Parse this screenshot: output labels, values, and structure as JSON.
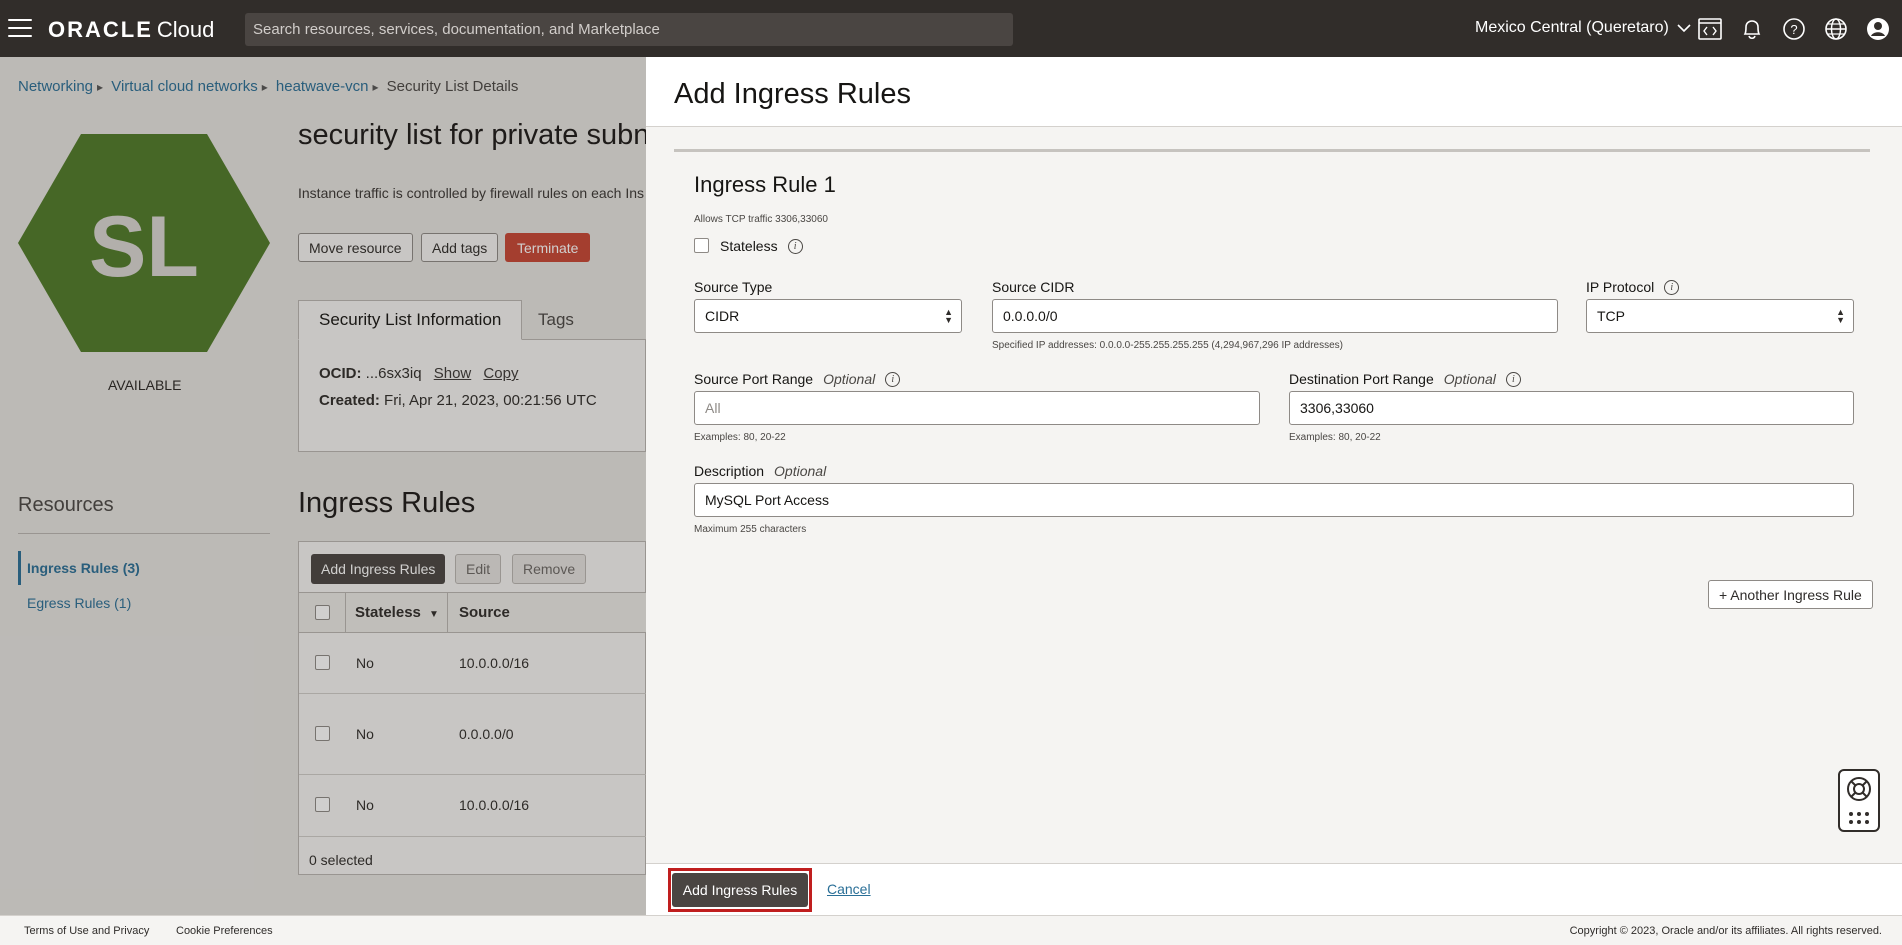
{
  "topbar": {
    "logo_brand": "ORACLE",
    "logo_product": "Cloud",
    "search_placeholder": "Search resources, services, documentation, and Marketplace",
    "region": "Mexico Central (Queretaro)",
    "icons": [
      "menu-icon",
      "cloud-shell-icon",
      "bell-icon",
      "help-icon",
      "globe-icon",
      "user-icon"
    ]
  },
  "breadcrumb": {
    "items": [
      "Networking",
      "Virtual cloud networks",
      "heatwave-vcn"
    ],
    "current": "Security List Details"
  },
  "resource": {
    "badge": "SL",
    "badge_color": "#4f7a28",
    "status": "AVAILABLE",
    "title": "security list for private subne",
    "description": "Instance traffic is controlled by firewall rules on each Ins",
    "actions": {
      "move": "Move resource",
      "tags": "Add tags",
      "terminate": "Terminate"
    },
    "tabs": [
      "Security List Information",
      "Tags"
    ],
    "ocid_label": "OCID:",
    "ocid_value": "...6sx3iq",
    "show": "Show",
    "copy": "Copy",
    "created_label": "Created:",
    "created_value": "Fri, Apr 21, 2023, 00:21:56 UTC"
  },
  "resources_nav": {
    "heading": "Resources",
    "items": [
      "Ingress Rules (3)",
      "Egress Rules (1)"
    ]
  },
  "ingress_section": {
    "heading": "Ingress Rules",
    "add_button": "Add Ingress Rules",
    "edit_button": "Edit",
    "remove_button": "Remove",
    "columns": [
      "Stateless",
      "Source"
    ],
    "rows": [
      {
        "stateless": "No",
        "source": "10.0.0.0/16"
      },
      {
        "stateless": "No",
        "source": "0.0.0.0/0"
      },
      {
        "stateless": "No",
        "source": "10.0.0.0/16"
      }
    ],
    "selected_count": "0 selected"
  },
  "panel": {
    "title": "Add Ingress Rules",
    "rule_title": "Ingress Rule 1",
    "rule_subtitle": "Allows TCP traffic 3306,33060",
    "stateless_label": "Stateless",
    "source_type": {
      "label": "Source Type",
      "value": "CIDR"
    },
    "source_cidr": {
      "label": "Source CIDR",
      "value": "0.0.0.0/0",
      "hint": "Specified IP addresses: 0.0.0.0-255.255.255.255 (4,294,967,296 IP addresses)"
    },
    "ip_protocol": {
      "label": "IP Protocol",
      "value": "TCP"
    },
    "source_port": {
      "label": "Source Port Range",
      "optional": "Optional",
      "placeholder": "All",
      "hint": "Examples: 80, 20-22"
    },
    "dest_port": {
      "label": "Destination Port Range",
      "optional": "Optional",
      "value": "3306,33060",
      "hint": "Examples: 80, 20-22"
    },
    "description": {
      "label": "Description",
      "optional": "Optional",
      "value": "MySQL Port Access",
      "hint": "Maximum 255 characters"
    },
    "another_rule": "+ Another Ingress Rule",
    "submit": "Add Ingress Rules",
    "cancel": "Cancel"
  },
  "footer": {
    "terms": "Terms of Use and Privacy",
    "cookies": "Cookie Preferences",
    "copyright": "Copyright © 2023, Oracle and/or its affiliates. All rights reserved."
  }
}
